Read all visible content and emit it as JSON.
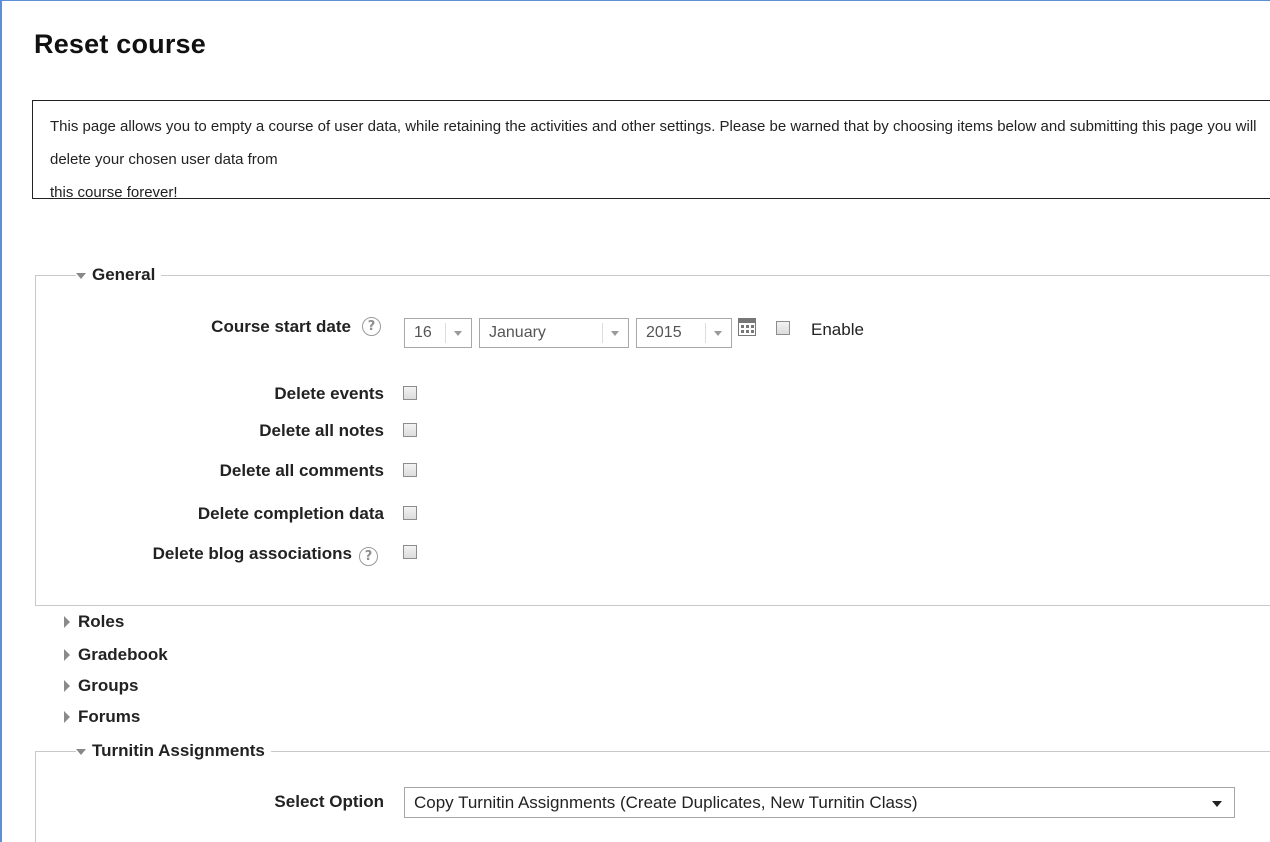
{
  "page": {
    "title": "Reset course",
    "intro_line1": "This page allows you to empty a course of user data, while retaining the activities and other settings. Please be warned that by choosing items below and submitting this page you will delete your chosen user data from",
    "intro_line2": "this course forever!"
  },
  "general": {
    "legend": "General",
    "course_start_date_label": "Course start date",
    "day": "16",
    "month": "January",
    "year": "2015",
    "enable_label": "Enable",
    "checkbox_items": [
      {
        "label": "Delete events"
      },
      {
        "label": "Delete all notes"
      },
      {
        "label": "Delete all comments"
      },
      {
        "label": "Delete completion data"
      },
      {
        "label": "Delete blog associations"
      }
    ]
  },
  "sections": {
    "roles": "Roles",
    "gradebook": "Gradebook",
    "groups": "Groups",
    "forums": "Forums"
  },
  "turnitin": {
    "legend": "Turnitin Assignments",
    "select_label": "Select Option",
    "selected_value": "Copy Turnitin Assignments (Create Duplicates, New Turnitin Class)"
  },
  "icons": {
    "help": "help-icon",
    "calendar": "calendar-icon",
    "expand": "triangle-down-icon",
    "collapse": "triangle-right-icon"
  },
  "colors": {
    "frame_border": "#5b8fd6",
    "fieldset_border": "#c9c9c9"
  }
}
